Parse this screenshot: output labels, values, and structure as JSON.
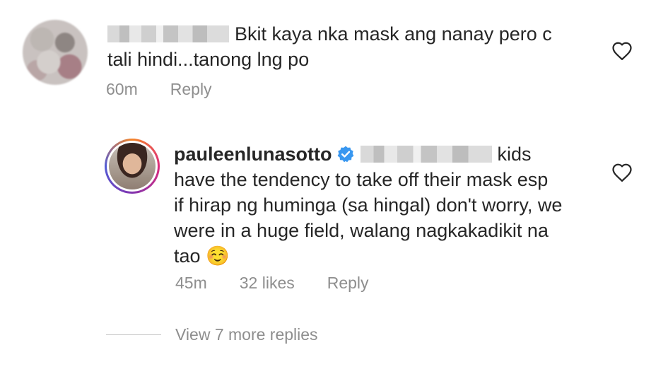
{
  "comments": [
    {
      "username": "",
      "text_line1": "Bkit kaya nka mask ang nanay pero c",
      "text_line2": "tali hindi...tanong lng po",
      "time": "60m",
      "reply_label": "Reply"
    },
    {
      "username": "pauleenlunasotto",
      "verified": true,
      "text_line1": "kids",
      "text_line2": "have the tendency to take off their mask esp",
      "text_line3": "if hirap ng huminga (sa hingal) don't worry, we",
      "text_line4": "were in a huge field, walang nagkakadikit na",
      "text_line5": "tao",
      "emoji": "☺️",
      "time": "45m",
      "likes": "32 likes",
      "reply_label": "Reply"
    }
  ],
  "view_more_label": "View 7 more replies",
  "icons": {
    "like": "heart-outline-icon",
    "verified": "verified-badge-icon"
  },
  "colors": {
    "text": "#262626",
    "meta": "#8e8e8e",
    "verified": "#3897f0"
  }
}
